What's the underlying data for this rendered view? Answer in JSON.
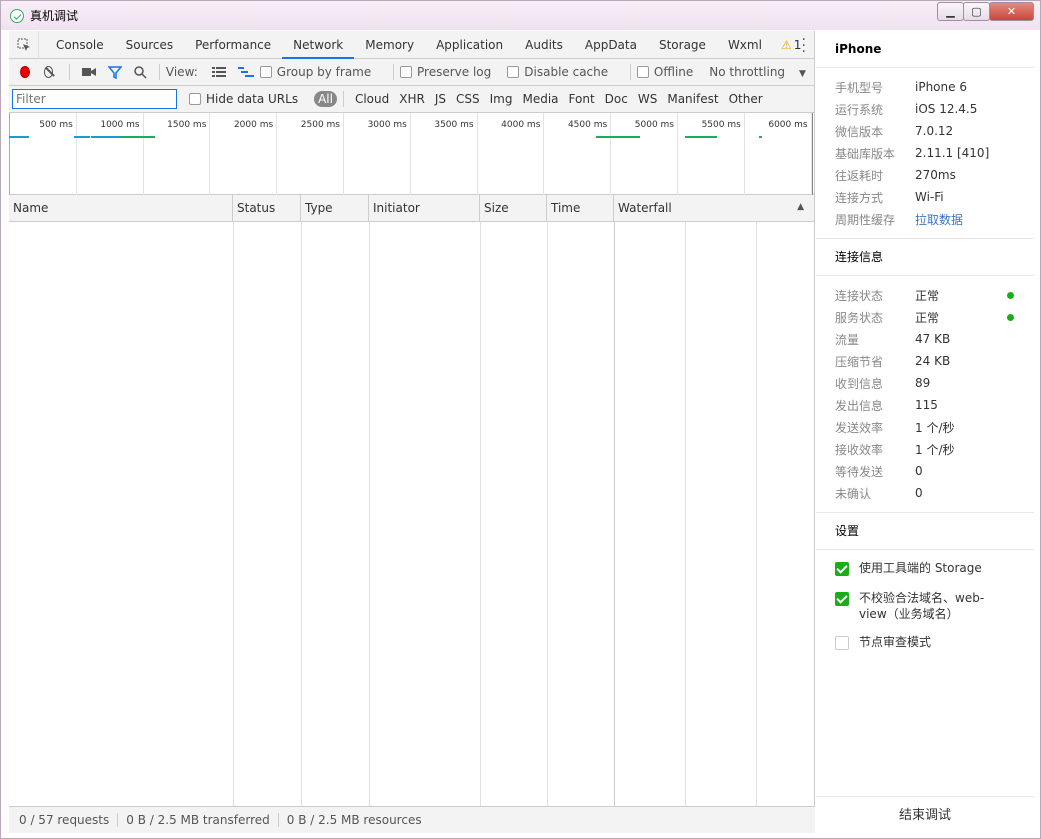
{
  "window": {
    "title": "真机调试"
  },
  "tabs": [
    "Console",
    "Sources",
    "Performance",
    "Network",
    "Memory",
    "Application",
    "Audits",
    "AppData",
    "Storage",
    "Wxml"
  ],
  "active_tab": "Network",
  "warnings_count": "1",
  "toolbar": {
    "view_label": "View:",
    "group_by_frame": "Group by frame",
    "preserve_log": "Preserve log",
    "disable_cache": "Disable cache",
    "offline": "Offline",
    "throttling": "No throttling"
  },
  "filterbar": {
    "placeholder": "Filter",
    "hide_data_urls": "Hide data URLs",
    "types": [
      "All",
      "Cloud",
      "XHR",
      "JS",
      "CSS",
      "Img",
      "Media",
      "Font",
      "Doc",
      "WS",
      "Manifest",
      "Other"
    ]
  },
  "overview": {
    "ticks": [
      "500 ms",
      "1000 ms",
      "1500 ms",
      "2000 ms",
      "2500 ms",
      "3000 ms",
      "3500 ms",
      "4000 ms",
      "4500 ms",
      "5000 ms",
      "5500 ms",
      "6000 ms"
    ]
  },
  "columns": [
    "Name",
    "Status",
    "Type",
    "Initiator",
    "Size",
    "Time",
    "Waterfall"
  ],
  "status": {
    "requests": "0 / 57 requests",
    "transferred": "0 B / 2.5 MB transferred",
    "resources": "0 B / 2.5 MB resources"
  },
  "side": {
    "device": "iPhone",
    "device_info": [
      {
        "k": "手机型号",
        "v": "iPhone 6"
      },
      {
        "k": "运行系统",
        "v": "iOS 12.4.5"
      },
      {
        "k": "微信版本",
        "v": "7.0.12"
      },
      {
        "k": "基础库版本",
        "v": "2.11.1 [410]"
      },
      {
        "k": "往返耗时",
        "v": "270ms"
      },
      {
        "k": "连接方式",
        "v": "Wi-Fi"
      },
      {
        "k": "周期性缓存",
        "v": "拉取数据"
      }
    ],
    "conn_title": "连接信息",
    "conn_info": [
      {
        "k": "连接状态",
        "v": "正常"
      },
      {
        "k": "服务状态",
        "v": "正常"
      },
      {
        "k": "流量",
        "v": "47 KB"
      },
      {
        "k": "压缩节省",
        "v": "24 KB"
      },
      {
        "k": "收到信息",
        "v": "89"
      },
      {
        "k": "发出信息",
        "v": "115"
      },
      {
        "k": "发送效率",
        "v": "1 个/秒"
      },
      {
        "k": "接收效率",
        "v": "1 个/秒"
      },
      {
        "k": "等待发送",
        "v": "0"
      },
      {
        "k": "未确认",
        "v": "0"
      }
    ],
    "settings_title": "设置",
    "settings": [
      {
        "label": "使用工具端的 Storage",
        "checked": true
      },
      {
        "label": "不校验合法域名、web-view（业务域名）",
        "checked": true
      },
      {
        "label": "节点审查模式",
        "checked": false
      }
    ],
    "end_button": "结束调试"
  }
}
